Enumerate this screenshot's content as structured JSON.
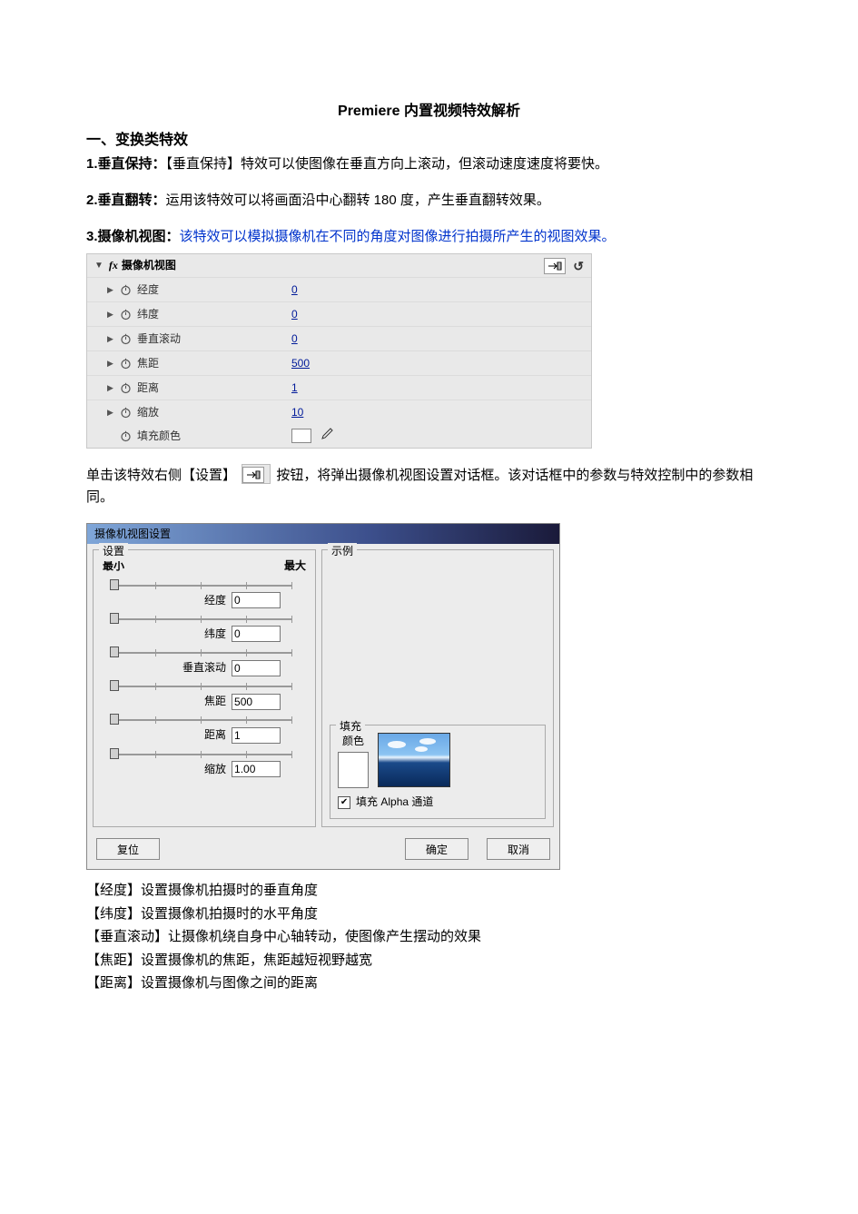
{
  "title": "Premiere  内置视频特效解析",
  "section1_heading": "一、变换类特效",
  "item1_label": "1.垂直保持：",
  "item1_text": "【垂直保持】特效可以使图像在垂直方向上滚动，但滚动速度速度将要快。",
  "item2_label": "2.垂直翻转：",
  "item2_text": "运用该特效可以将画面沿中心翻转 180 度，产生垂直翻转效果。",
  "item3_label": "3.摄像机视图：",
  "item3_text": "该特效可以模拟摄像机在不同的角度对图像进行拍摄所产生的视图效果。",
  "panel": {
    "title": "摄像机视图",
    "rows": [
      {
        "name": "经度",
        "value": "0",
        "expandable": true
      },
      {
        "name": "纬度",
        "value": "0",
        "expandable": true
      },
      {
        "name": "垂直滚动",
        "value": "0",
        "expandable": true
      },
      {
        "name": "焦距",
        "value": "500",
        "expandable": true
      },
      {
        "name": "距离",
        "value": "1",
        "expandable": true
      },
      {
        "name": "缩放",
        "value": "10",
        "expandable": true
      }
    ],
    "fill_label": "填充颜色"
  },
  "midtext_a": "单击该特效右侧【设置】",
  "midtext_b": "按钮，将弹出摄像机视图设置对话框。该对话框中的参数与特效控制中的参数相同。",
  "dialog": {
    "title": "摄像机视图设置",
    "settings_legend": "设置",
    "example_legend": "示例",
    "min_label": "最小",
    "max_label": "最大",
    "sliders": [
      {
        "label": "经度",
        "value": "0"
      },
      {
        "label": "纬度",
        "value": "0"
      },
      {
        "label": "垂直滚动",
        "value": "0"
      },
      {
        "label": "焦距",
        "value": "500"
      },
      {
        "label": "距离",
        "value": "1"
      },
      {
        "label": "缩放",
        "value": "1.00"
      }
    ],
    "fill_legend": "填充",
    "fill_color_label": "颜色",
    "alpha_label": "填充 Alpha 通道",
    "btn_reset": "复位",
    "btn_ok": "确定",
    "btn_cancel": "取消"
  },
  "explain": [
    "【经度】设置摄像机拍摄时的垂直角度",
    "【纬度】设置摄像机拍摄时的水平角度",
    "【垂直滚动】让摄像机绕自身中心轴转动，使图像产生摆动的效果",
    "【焦距】设置摄像机的焦距，焦距越短视野越宽",
    "【距离】设置摄像机与图像之间的距离"
  ]
}
